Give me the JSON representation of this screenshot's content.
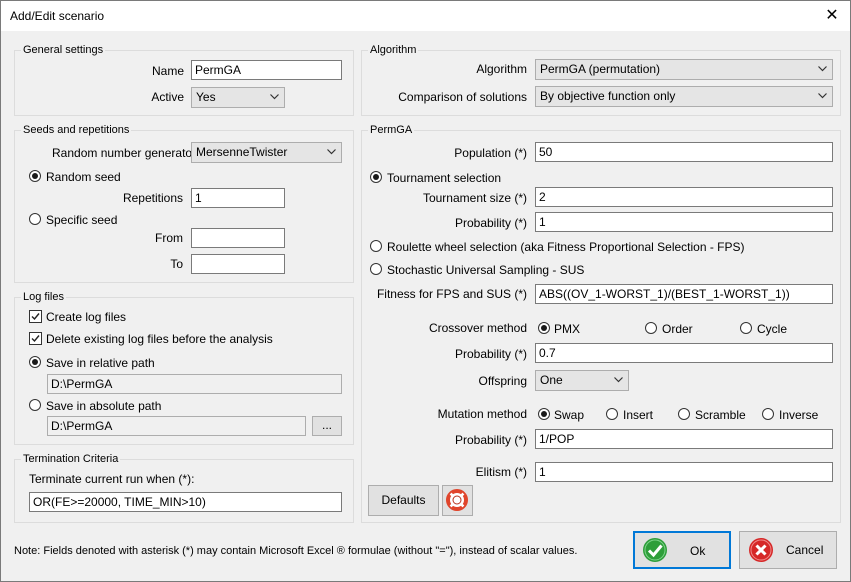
{
  "window": {
    "title": "Add/Edit scenario"
  },
  "general": {
    "title": "General settings",
    "name_label": "Name",
    "name_value": "PermGA",
    "active_label": "Active",
    "active_value": "Yes"
  },
  "seeds": {
    "title": "Seeds and repetitions",
    "rng_label": "Random number generator",
    "rng_value": "MersenneTwister",
    "random_seed_label": "Random seed",
    "repetitions_label": "Repetitions",
    "repetitions_value": "1",
    "specific_seed_label": "Specific seed",
    "from_label": "From",
    "from_value": "",
    "to_label": "To",
    "to_value": ""
  },
  "logs": {
    "title": "Log files",
    "create_label": "Create log files",
    "delete_label": "Delete existing log files before the analysis",
    "relative_label": "Save in relative path",
    "relative_value": "D:\\PermGA",
    "absolute_label": "Save in absolute path",
    "absolute_value": "D:\\PermGA",
    "browse_label": "..."
  },
  "termination": {
    "title": "Termination Criteria",
    "label": "Terminate current run when (*):",
    "value": "OR(FE>=20000, TIME_MIN>10)"
  },
  "algorithm": {
    "title": "Algorithm",
    "algorithm_label": "Algorithm",
    "algorithm_value": "PermGA (permutation)",
    "comparison_label": "Comparison of solutions",
    "comparison_value": "By objective function only"
  },
  "permga": {
    "title": "PermGA",
    "population_label": "Population (*)",
    "population_value": "50",
    "tournament_label": "Tournament selection",
    "tournament_size_label": "Tournament size (*)",
    "tournament_size_value": "2",
    "tournament_prob_label": "Probability (*)",
    "tournament_prob_value": "1",
    "roulette_label": "Roulette wheel selection (aka Fitness Proportional Selection - FPS)",
    "sus_label": "Stochastic Universal Sampling - SUS",
    "fitness_label": "Fitness for FPS and SUS (*)",
    "fitness_value": "ABS((OV_1-WORST_1)/(BEST_1-WORST_1))",
    "crossover_label": "Crossover method",
    "crossover_options": [
      "PMX",
      "Order",
      "Cycle"
    ],
    "crossover_prob_label": "Probability (*)",
    "crossover_prob_value": "0.7",
    "offspring_label": "Offspring",
    "offspring_value": "One",
    "mutation_label": "Mutation method",
    "mutation_options": [
      "Swap",
      "Insert",
      "Scramble",
      "Inverse"
    ],
    "mutation_prob_label": "Probability (*)",
    "mutation_prob_value": "1/POP",
    "elitism_label": "Elitism (*)",
    "elitism_value": "1"
  },
  "footer": {
    "defaults_label": "Defaults",
    "note": "Note: Fields denoted with asterisk (*) may contain Microsoft Excel ® formulae (without \"=\"), instead of scalar values.",
    "ok_label": "Ok",
    "cancel_label": "Cancel"
  },
  "colors": {
    "focus_border": "#0078d7",
    "ok_icon": "#2e9e3a",
    "cancel_icon": "#d62828",
    "help_icon": "#e0452c"
  }
}
